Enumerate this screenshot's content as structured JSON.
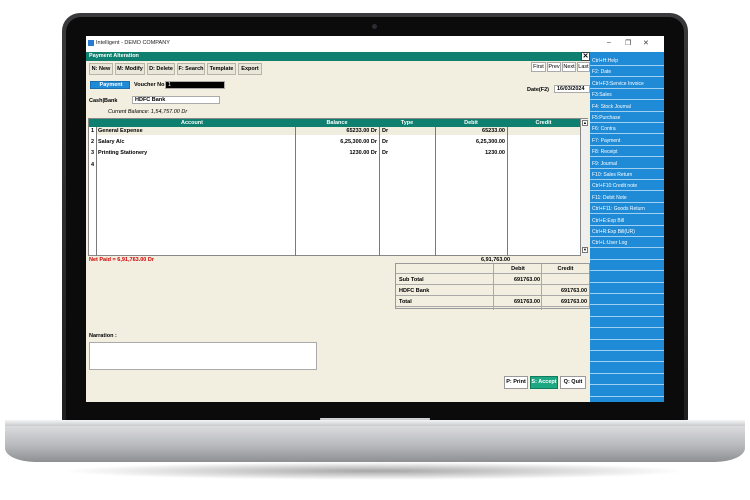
{
  "window": {
    "title": "Intelligent - DEMO COMPANY"
  },
  "form": {
    "title": "Payment Alteration",
    "toolbar": [
      "N: New",
      "M: Modify",
      "D: Delete",
      "F: Search",
      "Template",
      "Export"
    ],
    "nav": [
      "First",
      "Prev",
      "Next",
      "Last"
    ],
    "type_label": "Payment",
    "voucher_label": "Voucher No",
    "voucher_no": "1",
    "date_label": "Date(F2)",
    "date": "16/03/2024",
    "cashbank_label": "Cash|Bank",
    "cashbank": "HDFC Bank",
    "current_balance": "Current Balance: 1,54,757.00 Dr"
  },
  "grid": {
    "columns": [
      "Account",
      "Balance",
      "Type",
      "Debit",
      "Credit"
    ],
    "rows": [
      {
        "no": "1",
        "account": "General Expense",
        "balance": "65233.00 Dr",
        "type": "Dr",
        "debit": "65233.00",
        "credit": ""
      },
      {
        "no": "2",
        "account": "Salary A/c",
        "balance": "6,25,300.00 Dr",
        "type": "Dr",
        "debit": "6,25,300.00",
        "credit": ""
      },
      {
        "no": "3",
        "account": "Printing Stationery",
        "balance": "1230.00 Dr",
        "type": "Dr",
        "debit": "1230.00",
        "credit": ""
      },
      {
        "no": "4",
        "account": "",
        "balance": "",
        "type": "",
        "debit": "",
        "credit": ""
      }
    ],
    "net_paid": "Net Paid = 6,91,763.00 Dr",
    "debit_total": "6,91,763.00"
  },
  "totals": {
    "headers": [
      "Debit",
      "Credit"
    ],
    "rows": [
      {
        "label": "Sub Total",
        "debit": "691763.00",
        "credit": ""
      },
      {
        "label": "HDFC Bank",
        "debit": "",
        "credit": "691763.00"
      },
      {
        "label": "Total",
        "debit": "691763.00",
        "credit": "691763.00"
      }
    ]
  },
  "narration_label": "Narration :",
  "actions": [
    "P: Print",
    "S: Accept",
    "Q: Quit"
  ],
  "side_menu": [
    "Ctrl+H:Help",
    "F2: Date",
    "Ctrl+F3:Service Invoice",
    "F3:Sales",
    "F4: Stock Journal",
    "F5:Purchase",
    "F6: Contra",
    "F7: Payment",
    "F8: Receipt",
    "F9: Journal",
    "F10: Sales Return",
    "Ctrl+F10:Credit note",
    "F11: Debit Note",
    "Ctrl+F11: Goods Return",
    "Ctrl+E:Exp Bill",
    "Ctrl+R:Exp Bill(UR)",
    "Ctrl+L:User Log"
  ],
  "colors": {
    "header_green": "#0f7f6f",
    "side_blue": "#1f8ad6",
    "accept_green": "#1ea882",
    "net_paid_red": "#d00000"
  }
}
